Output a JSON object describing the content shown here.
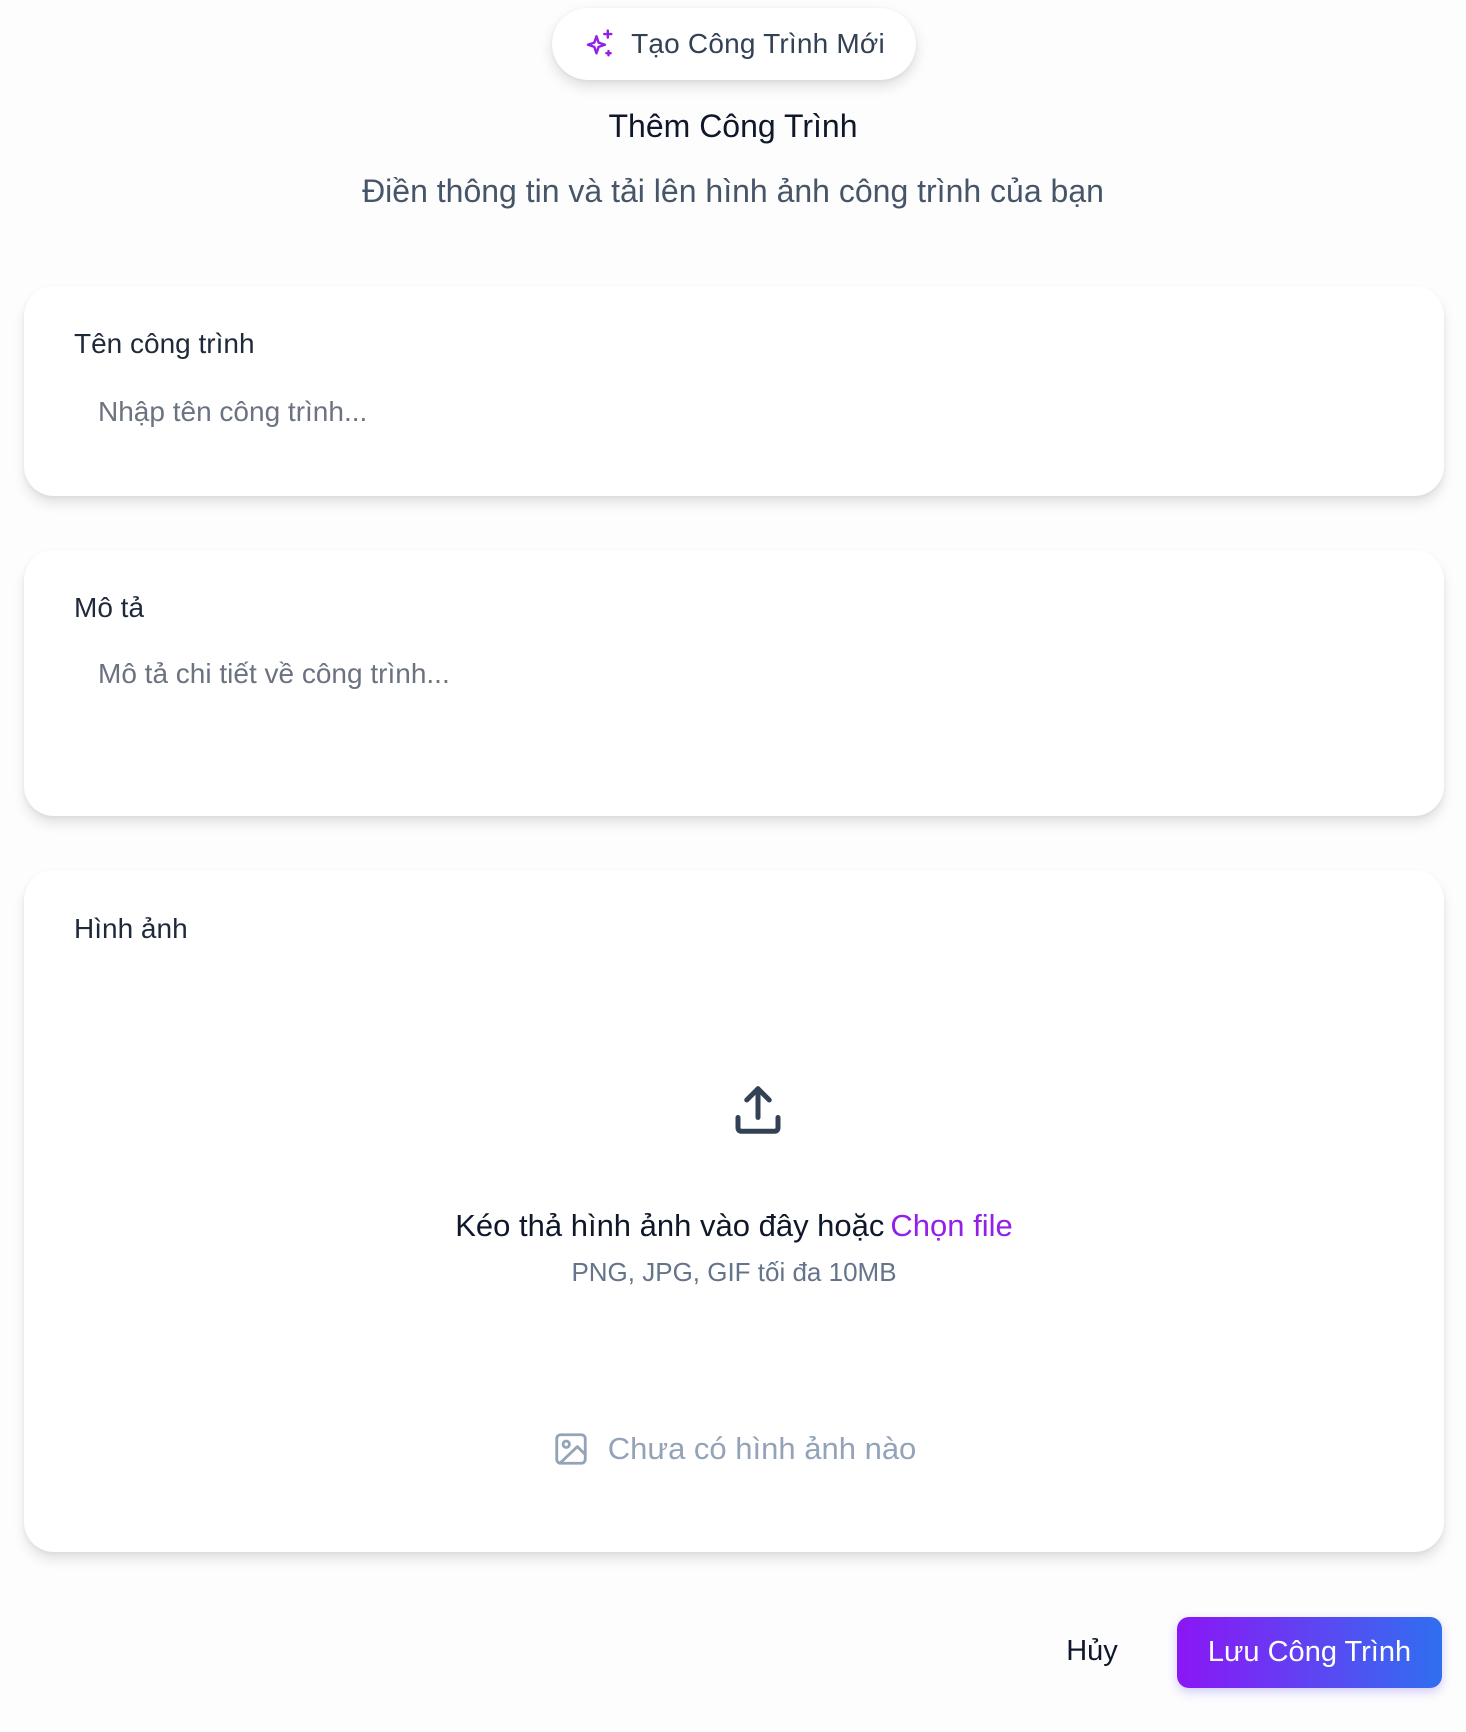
{
  "badge": {
    "label": "Tạo Công Trình Mới",
    "icon": "sparkles-icon",
    "icon_color": "#9320e8"
  },
  "header": {
    "title": "Thêm Công Trình",
    "subtitle": "Điền thông tin và tải lên hình ảnh công trình của bạn"
  },
  "name_field": {
    "label": "Tên công trình",
    "value": "",
    "placeholder": "Nhập tên công trình..."
  },
  "description_field": {
    "label": "Mô tả",
    "value": "",
    "placeholder": "Mô tả chi tiết về công trình..."
  },
  "image_field": {
    "label": "Hình ảnh",
    "upload_icon": "upload-icon",
    "drop_text": "Kéo thả hình ảnh vào đây hoặc",
    "choose_file": "Chọn file",
    "hint": "PNG, JPG, GIF tối đa 10MB",
    "empty_icon": "image-icon",
    "empty_text": "Chưa có hình ảnh nào"
  },
  "actions": {
    "cancel": "Hủy",
    "save": "Lưu Công Trình"
  },
  "colors": {
    "accent": "#9320e8",
    "gradient_start": "#8b16f5",
    "gradient_end": "#2f6ff0"
  }
}
